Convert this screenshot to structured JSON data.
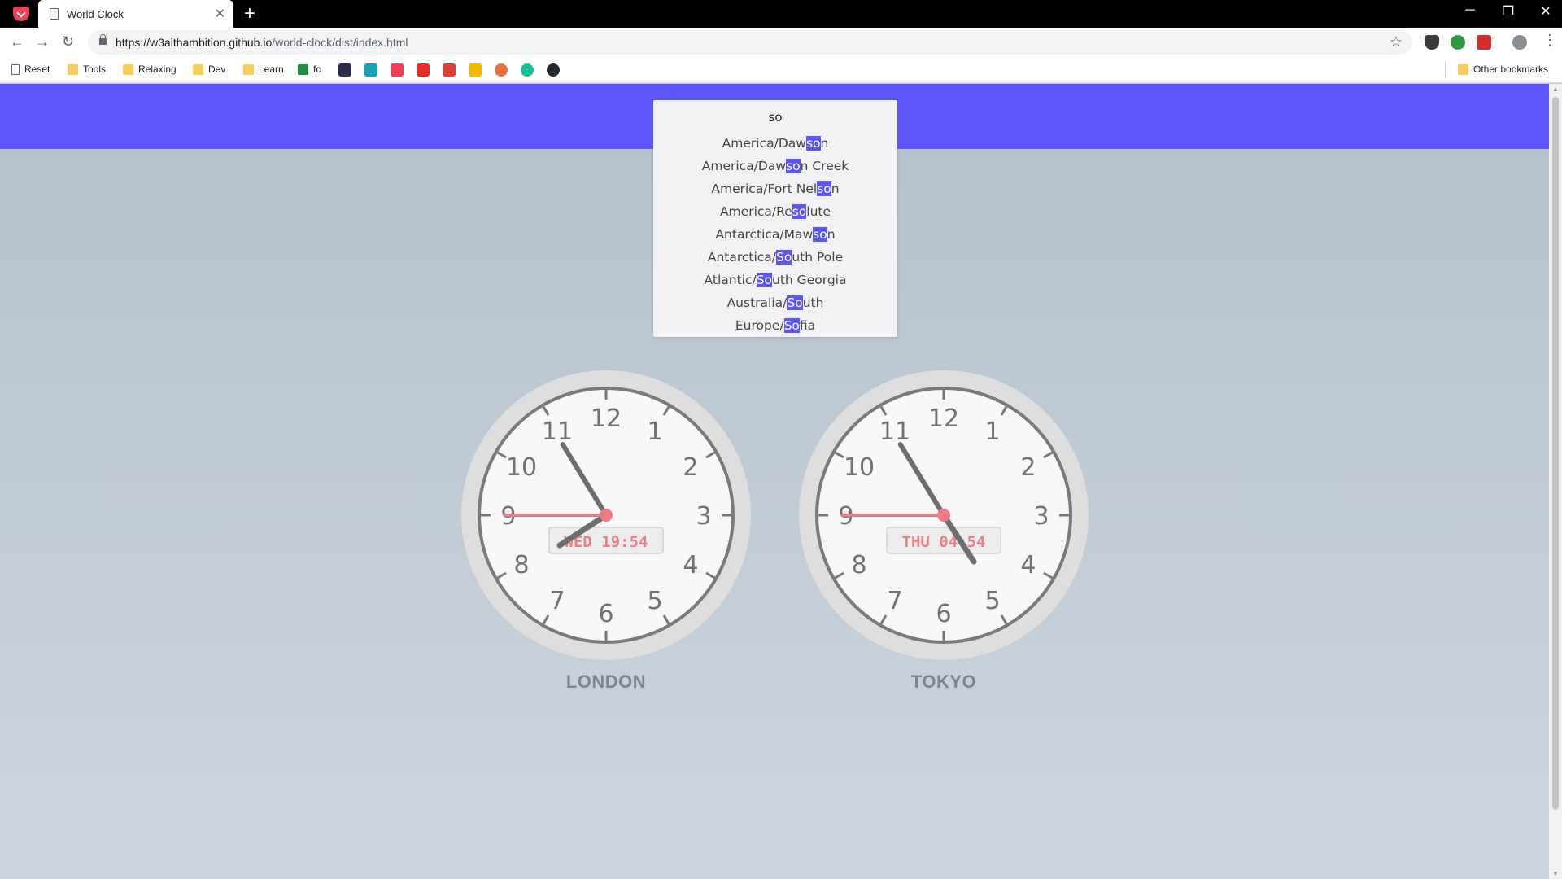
{
  "browser": {
    "tab_title": "World Clock",
    "url_host": "https://w3althambition.github.io",
    "url_path": "/world-clock/dist/index.html",
    "bookmarks": [
      "Reset",
      "Tools",
      "Relaxing",
      "Dev",
      "Learn",
      "fc"
    ],
    "other_bookmarks": "Other bookmarks"
  },
  "search": {
    "query": "so",
    "results": [
      {
        "pre": "America/Daw",
        "match": "so",
        "post": "n"
      },
      {
        "pre": "America/Daw",
        "match": "so",
        "post": "n Creek"
      },
      {
        "pre": "America/Fort Nel",
        "match": "so",
        "post": "n"
      },
      {
        "pre": "America/Re",
        "match": "so",
        "post": "lute"
      },
      {
        "pre": "Antarctica/Maw",
        "match": "so",
        "post": "n"
      },
      {
        "pre": "Antarctica/",
        "match": "So",
        "post": "uth Pole"
      },
      {
        "pre": "Atlantic/",
        "match": "So",
        "post": "uth Georgia"
      },
      {
        "pre": "Australia/",
        "match": "So",
        "post": "uth"
      },
      {
        "pre": "Europe/",
        "match": "So",
        "post": "fia"
      }
    ]
  },
  "clocks": [
    {
      "city": "LONDON",
      "display": "WED 19:54",
      "hour": 19,
      "minute": 54,
      "second": 45
    },
    {
      "city": "TOKYO",
      "display": "THU 04:54",
      "hour": 4,
      "minute": 54,
      "second": 45
    }
  ],
  "colors": {
    "accent": "#5c55fb",
    "second_hand": "#ee7b84",
    "hand": "#6e6e6e",
    "digital_text": "#e8808a"
  }
}
